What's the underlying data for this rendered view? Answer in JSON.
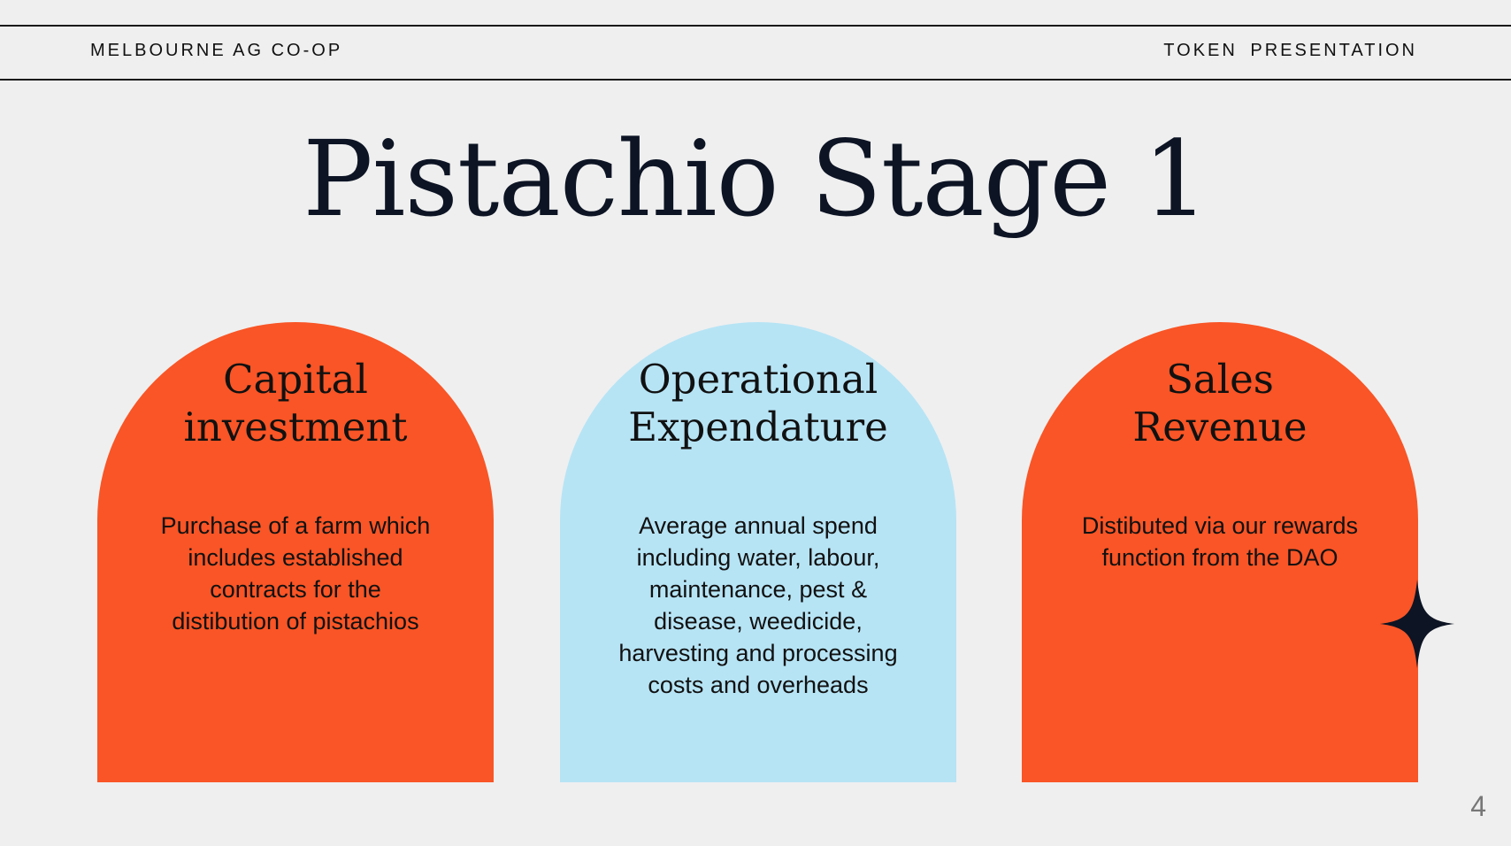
{
  "header": {
    "brand": "MELBOURNE AG CO-OP",
    "deck_label": "TOKEN  PRESENTATION"
  },
  "title": "Pistachio Stage 1",
  "cards": [
    {
      "heading_lines": [
        "Capital",
        "investment"
      ],
      "body": "Purchase of a farm which includes established contracts for the distibution of pistachios",
      "color": "#f95526"
    },
    {
      "heading_lines": [
        "Operational",
        "Expendature"
      ],
      "body": "Average annual spend including water, labour, maintenance, pest & disease, weedicide, harvesting and processing costs and overheads",
      "color": "#b6e4f5"
    },
    {
      "heading_lines": [
        "Sales",
        "Revenue"
      ],
      "body": "Distibuted via our rewards function from the DAO",
      "color": "#f95526"
    }
  ],
  "decoration": {
    "icon": "four-point-star-icon",
    "color": "#0d1424"
  },
  "page_number": "4"
}
